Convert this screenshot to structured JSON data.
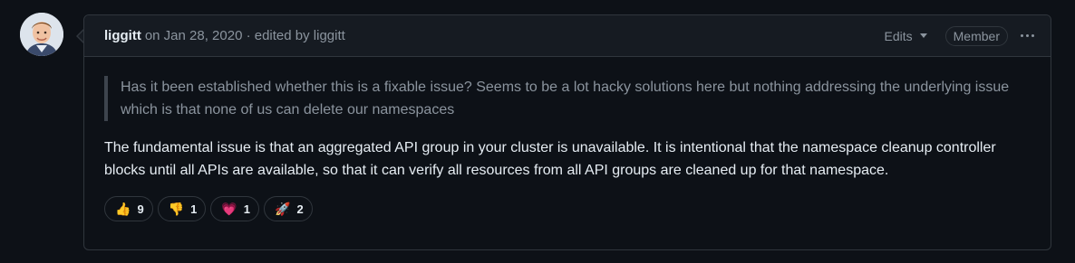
{
  "comment": {
    "author": "liggitt",
    "meta": "on Jan 28, 2020 · edited by liggitt",
    "edits_label": "Edits",
    "role_badge": "Member",
    "quote": "Has it been established whether this is a fixable issue? Seems to be a lot hacky solutions here but nothing addressing the underlying issue which is that none of us can delete our namespaces",
    "body": "The fundamental issue is that an aggregated API group in your cluster is unavailable. It is intentional that the namespace cleanup controller blocks until all APIs are available, so that it can verify all resources from all API groups are cleaned up for that namespace."
  },
  "reactions": [
    {
      "icon": "thumbs-up-icon",
      "emoji": "👍",
      "count": "9"
    },
    {
      "icon": "thumbs-down-icon",
      "emoji": "👎",
      "count": "1"
    },
    {
      "icon": "heart-icon",
      "emoji": "💗",
      "count": "1"
    },
    {
      "icon": "rocket-icon",
      "emoji": "🚀",
      "count": "2"
    }
  ],
  "colors": {
    "background": "#0d1117",
    "header": "#161b22",
    "border": "#30363d",
    "muted_text": "#8b949e",
    "text": "#e6edf3"
  }
}
